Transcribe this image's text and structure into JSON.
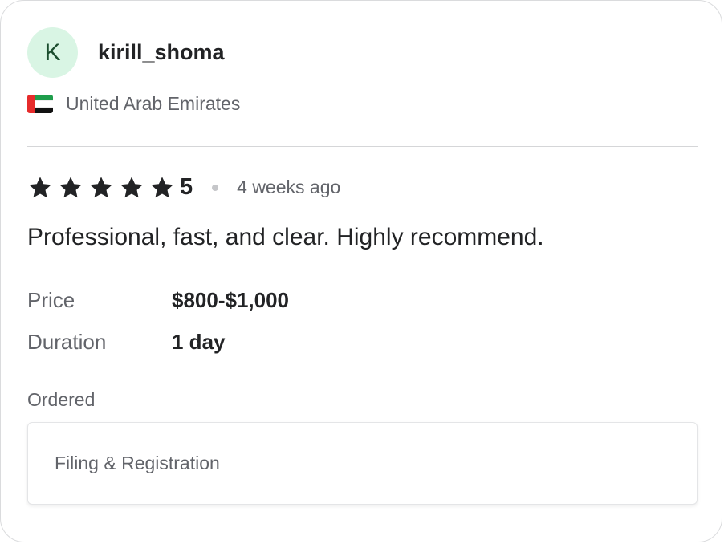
{
  "reviewer": {
    "avatar_initial": "K",
    "username": "kirill_shoma",
    "country": "United Arab Emirates",
    "flag_icon": "uae-flag-icon"
  },
  "review": {
    "stars": 5,
    "rating": "5",
    "time_ago": "4 weeks ago",
    "text": "Professional, fast, and clear. Highly recommend."
  },
  "details": {
    "price_label": "Price",
    "price_value": "$800-$1,000",
    "duration_label": "Duration",
    "duration_value": "1 day"
  },
  "ordered": {
    "label": "Ordered",
    "item": "Filing & Registration"
  },
  "colors": {
    "avatar_bg": "#d9f5e4",
    "star": "#222325",
    "muted_text": "#62646a"
  }
}
